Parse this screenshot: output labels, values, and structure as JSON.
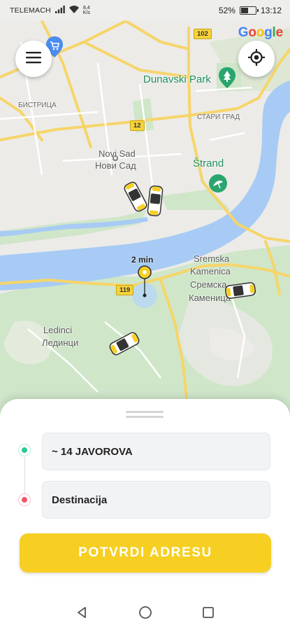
{
  "status_bar": {
    "carrier": "TELEMACH",
    "net_speed_value": "8,4",
    "net_speed_unit": "K/s",
    "battery_percent": "52%",
    "battery_level": 0.52,
    "time": "13:12"
  },
  "map": {
    "google_logo": [
      "G",
      "o",
      "o",
      "g",
      "l",
      "e"
    ],
    "google_colors": [
      "#4285F4",
      "#EA4335",
      "#FBBC05",
      "#4285F4",
      "#34A853",
      "#EA4335"
    ],
    "labels": {
      "bistrica": "БИСТРИЦА",
      "dunavski_park": "Dunavski Park",
      "stari_grad": "СТАРИ ГРАД",
      "novi_sad_lat": "Novi Sad",
      "novi_sad_cyr": "Нови Сад",
      "strand": "Štrand",
      "sremska_lat_1": "Sremska",
      "sremska_lat_2": "Kamenica",
      "sremska_cyr_1": "Сремска",
      "sremska_cyr_2": "Каменица",
      "ledinci_lat": "Ledinci",
      "ledinci_cyr": "Лединци"
    },
    "road_numbers": {
      "r102": "102",
      "r12": "12",
      "r119": "119"
    },
    "pickup_eta": "2 min",
    "colors": {
      "water": "#a7cbf4",
      "park": "#cfe6c9",
      "road": "#f6d56a",
      "accent": "#f6cf22"
    }
  },
  "sheet": {
    "pickup_value": "~ 14 JAVOROVA",
    "destination_placeholder": "Destinacija",
    "confirm_label": "POTVRDI ADRESU",
    "pickup_dot_color": "#2ec79a",
    "destination_dot_color": "#f0566a"
  },
  "icons": {
    "menu": "hamburger-icon",
    "locate": "crosshair-icon",
    "back": "triangle-back-icon",
    "home": "circle-home-icon",
    "recents": "square-recents-icon"
  }
}
